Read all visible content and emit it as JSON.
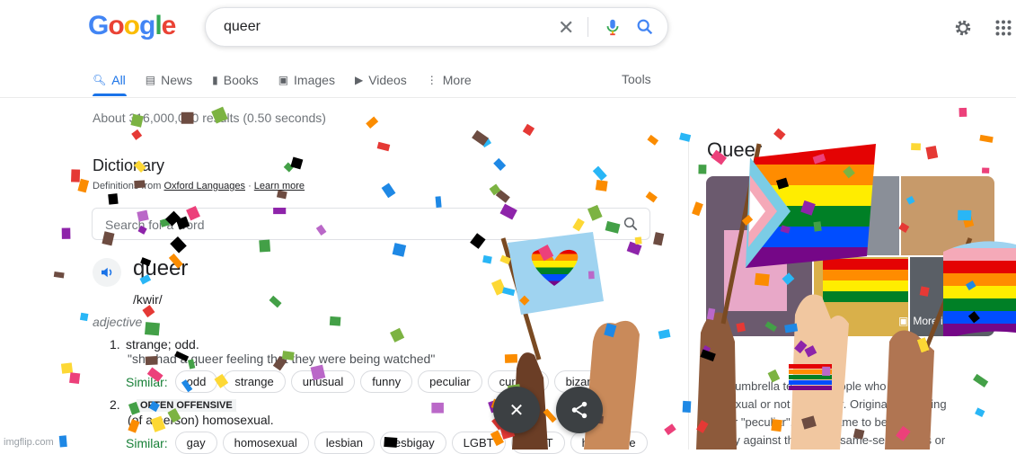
{
  "header": {
    "logo_letters": [
      "G",
      "o",
      "o",
      "g",
      "l",
      "e"
    ],
    "logo_colors": [
      "#4285f4",
      "#ea4335",
      "#fbbc05",
      "#4285f4",
      "#34a853",
      "#ea4335"
    ],
    "query": "queer"
  },
  "tabs": [
    {
      "label": "All",
      "icon": "search-icon",
      "active": true
    },
    {
      "label": "News",
      "icon": "news-icon"
    },
    {
      "label": "Books",
      "icon": "book-icon"
    },
    {
      "label": "Images",
      "icon": "image-icon"
    },
    {
      "label": "Videos",
      "icon": "video-icon"
    },
    {
      "label": "More",
      "icon": "more-dots-icon"
    }
  ],
  "tools_label": "Tools",
  "result_stats": "About 316,000,000 results (0.50 seconds)",
  "dictionary": {
    "title": "Dictionary",
    "source_prefix": "Definitions from",
    "source": "Oxford Languages",
    "separator": "·",
    "learn_more": "Learn more",
    "search_placeholder": "Search for a word",
    "word": "queer",
    "pronunciation": "/kwir/",
    "part_of_speech": "adjective",
    "senses": [
      {
        "number": "1.",
        "definition": "strange; odd.",
        "example": "\"she had a queer feeling that they were being watched\"",
        "similar_label": "Similar:",
        "similar": [
          "odd",
          "strange",
          "unusual",
          "funny",
          "peculiar",
          "curious",
          "bizarre"
        ]
      },
      {
        "number": "2.",
        "label": "OFTEN OFFENSIVE",
        "definition": "(of a person) homosexual.",
        "similar_label": "Similar:",
        "similar": [
          "gay",
          "homosexual",
          "lesbian",
          "lesbigay",
          "LGBT",
          "GLBT",
          "homophile"
        ]
      }
    ]
  },
  "knowledge_panel": {
    "title": "Queer",
    "more_images": "More images",
    "description_lines": [
      "is an umbrella term for people who are not",
      "mosexual or not cisgender. Originally meaning",
      "ge\" or \"peculiar\", queer came to be used",
      "atively against those with same-sex desires or"
    ]
  },
  "overlay": {
    "watermark": "imgflip.com",
    "flag_colors": [
      "#e40303",
      "#ff8c00",
      "#ffed00",
      "#008026",
      "#004dff",
      "#750787"
    ],
    "confetti_colors": [
      "#e53935",
      "#8e24aa",
      "#1e88e5",
      "#43a047",
      "#fdd835",
      "#fb8c00",
      "#000000",
      "#6d4c41",
      "#29b6f6",
      "#ec407a",
      "#7cb342",
      "#ba68c8"
    ]
  },
  "colors": {
    "accent": "#1a73e8",
    "similar_green": "#188038",
    "fab_bg": "#3c4043"
  }
}
